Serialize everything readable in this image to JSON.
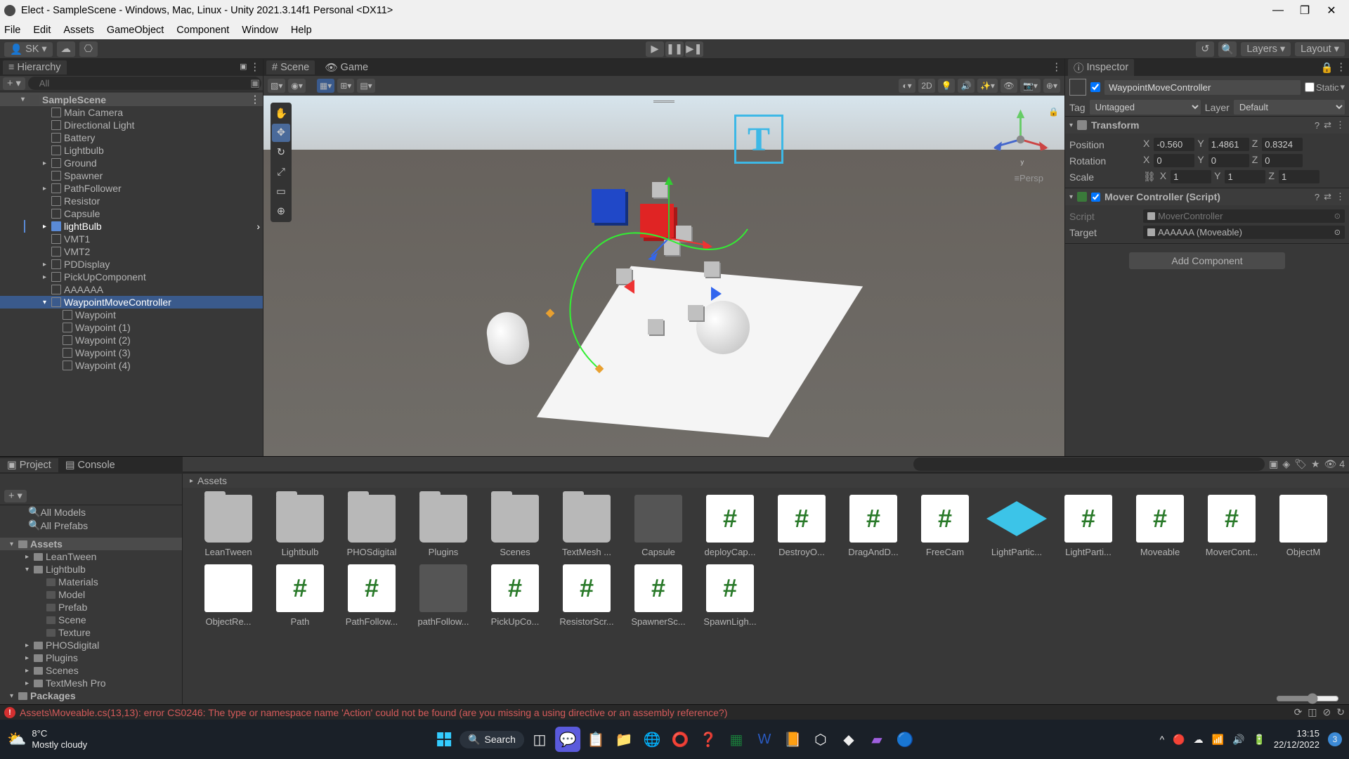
{
  "title_bar": {
    "title": "Elect - SampleScene - Windows, Mac, Linux - Unity 2021.3.14f1 Personal <DX11>"
  },
  "menu": [
    "File",
    "Edit",
    "Assets",
    "GameObject",
    "Component",
    "Window",
    "Help"
  ],
  "top_toolbar": {
    "account": "SK",
    "layers": "Layers",
    "layout": "Layout"
  },
  "hierarchy": {
    "tab_label": "Hierarchy",
    "search_placeholder": "All",
    "scene": "SampleScene",
    "items": [
      {
        "name": "Main Camera",
        "depth": 1
      },
      {
        "name": "Directional Light",
        "depth": 1
      },
      {
        "name": "Battery",
        "depth": 1
      },
      {
        "name": "Lightbulb",
        "depth": 1
      },
      {
        "name": "Ground",
        "depth": 1,
        "expandable": true
      },
      {
        "name": "Spawner",
        "depth": 1
      },
      {
        "name": "PathFollower",
        "depth": 1,
        "expandable": true
      },
      {
        "name": "Resistor",
        "depth": 1
      },
      {
        "name": "Capsule",
        "depth": 1
      },
      {
        "name": "lightBulb",
        "depth": 1,
        "expandable": true,
        "prefab": true,
        "modified": true
      },
      {
        "name": "VMT1",
        "depth": 1
      },
      {
        "name": "VMT2",
        "depth": 1
      },
      {
        "name": "PDDisplay",
        "depth": 1,
        "expandable": true
      },
      {
        "name": "PickUpComponent",
        "depth": 1,
        "expandable": true
      },
      {
        "name": "AAAAAA",
        "depth": 1
      },
      {
        "name": "WaypointMoveController",
        "depth": 1,
        "expandable": true,
        "selected": true,
        "expanded": true
      },
      {
        "name": "Waypoint",
        "depth": 2
      },
      {
        "name": "Waypoint (1)",
        "depth": 2
      },
      {
        "name": "Waypoint (2)",
        "depth": 2
      },
      {
        "name": "Waypoint (3)",
        "depth": 2
      },
      {
        "name": "Waypoint (4)",
        "depth": 2
      }
    ]
  },
  "scene_tabs": {
    "scene": "Scene",
    "game": "Game"
  },
  "scene_toolbar": {
    "mode_2d": "2D",
    "persp": "≡Persp"
  },
  "inspector": {
    "tab_label": "Inspector",
    "object_name": "WaypointMoveController",
    "static_label": "Static",
    "tag_label": "Tag",
    "tag_value": "Untagged",
    "layer_label": "Layer",
    "layer_value": "Default",
    "transform": {
      "title": "Transform",
      "position": {
        "label": "Position",
        "x": "-0.560",
        "y": "1.4861",
        "z": "0.8324"
      },
      "rotation": {
        "label": "Rotation",
        "x": "0",
        "y": "0",
        "z": "0"
      },
      "scale": {
        "label": "Scale",
        "x": "1",
        "y": "1",
        "z": "1"
      }
    },
    "mover": {
      "title": "Mover Controller (Script)",
      "script_label": "Script",
      "script_value": "MoverController",
      "target_label": "Target",
      "target_value": "AAAAAA (Moveable)"
    },
    "add_component": "Add Component"
  },
  "bottom_tabs": {
    "project": "Project",
    "console": "Console"
  },
  "project_tree": {
    "favorites_items": [
      "All Models",
      "All Prefabs"
    ],
    "assets_label": "Assets",
    "folders": [
      {
        "name": "LeanTween",
        "depth": 1
      },
      {
        "name": "Lightbulb",
        "depth": 1,
        "expanded": true
      },
      {
        "name": "Materials",
        "depth": 2,
        "dark": true
      },
      {
        "name": "Model",
        "depth": 2,
        "dark": true
      },
      {
        "name": "Prefab",
        "depth": 2,
        "dark": true
      },
      {
        "name": "Scene",
        "depth": 2,
        "dark": true
      },
      {
        "name": "Texture",
        "depth": 2,
        "dark": true
      },
      {
        "name": "PHOSdigital",
        "depth": 1
      },
      {
        "name": "Plugins",
        "depth": 1
      },
      {
        "name": "Scenes",
        "depth": 1
      },
      {
        "name": "TextMesh Pro",
        "depth": 1
      }
    ],
    "packages_label": "Packages"
  },
  "breadcrumb": "Assets",
  "search_count": "4",
  "assets": [
    {
      "name": "LeanTween",
      "type": "folder"
    },
    {
      "name": "Lightbulb",
      "type": "folder"
    },
    {
      "name": "PHOSdigital",
      "type": "folder"
    },
    {
      "name": "Plugins",
      "type": "folder"
    },
    {
      "name": "Scenes",
      "type": "folder"
    },
    {
      "name": "TextMesh ...",
      "type": "folder"
    },
    {
      "name": "Capsule",
      "type": "capsule"
    },
    {
      "name": "deployCap...",
      "type": "script"
    },
    {
      "name": "DestroyO...",
      "type": "script"
    },
    {
      "name": "DragAndD...",
      "type": "script"
    },
    {
      "name": "FreeCam",
      "type": "script"
    },
    {
      "name": "LightPartic...",
      "type": "cubeblue"
    },
    {
      "name": "LightParti...",
      "type": "script"
    },
    {
      "name": "Moveable",
      "type": "script"
    },
    {
      "name": "MoverCont...",
      "type": "script"
    },
    {
      "name": "ObjectM",
      "type": "matred"
    },
    {
      "name": "ObjectRe...",
      "type": "matblue"
    },
    {
      "name": "Path",
      "type": "script"
    },
    {
      "name": "PathFollow...",
      "type": "script"
    },
    {
      "name": "pathFollow...",
      "type": "cube"
    },
    {
      "name": "PickUpCo...",
      "type": "script"
    },
    {
      "name": "ResistorScr...",
      "type": "script"
    },
    {
      "name": "SpawnerSc...",
      "type": "script"
    },
    {
      "name": "SpawnLigh...",
      "type": "script"
    }
  ],
  "console_error": "Assets\\Moveable.cs(13,13): error CS0246: The type or namespace name 'Action' could not be found (are you missing a using directive or an assembly reference?)",
  "taskbar": {
    "temp": "8°C",
    "weather": "Mostly cloudy",
    "search": "Search",
    "time": "13:15",
    "date": "22/12/2022",
    "notif": "3"
  }
}
